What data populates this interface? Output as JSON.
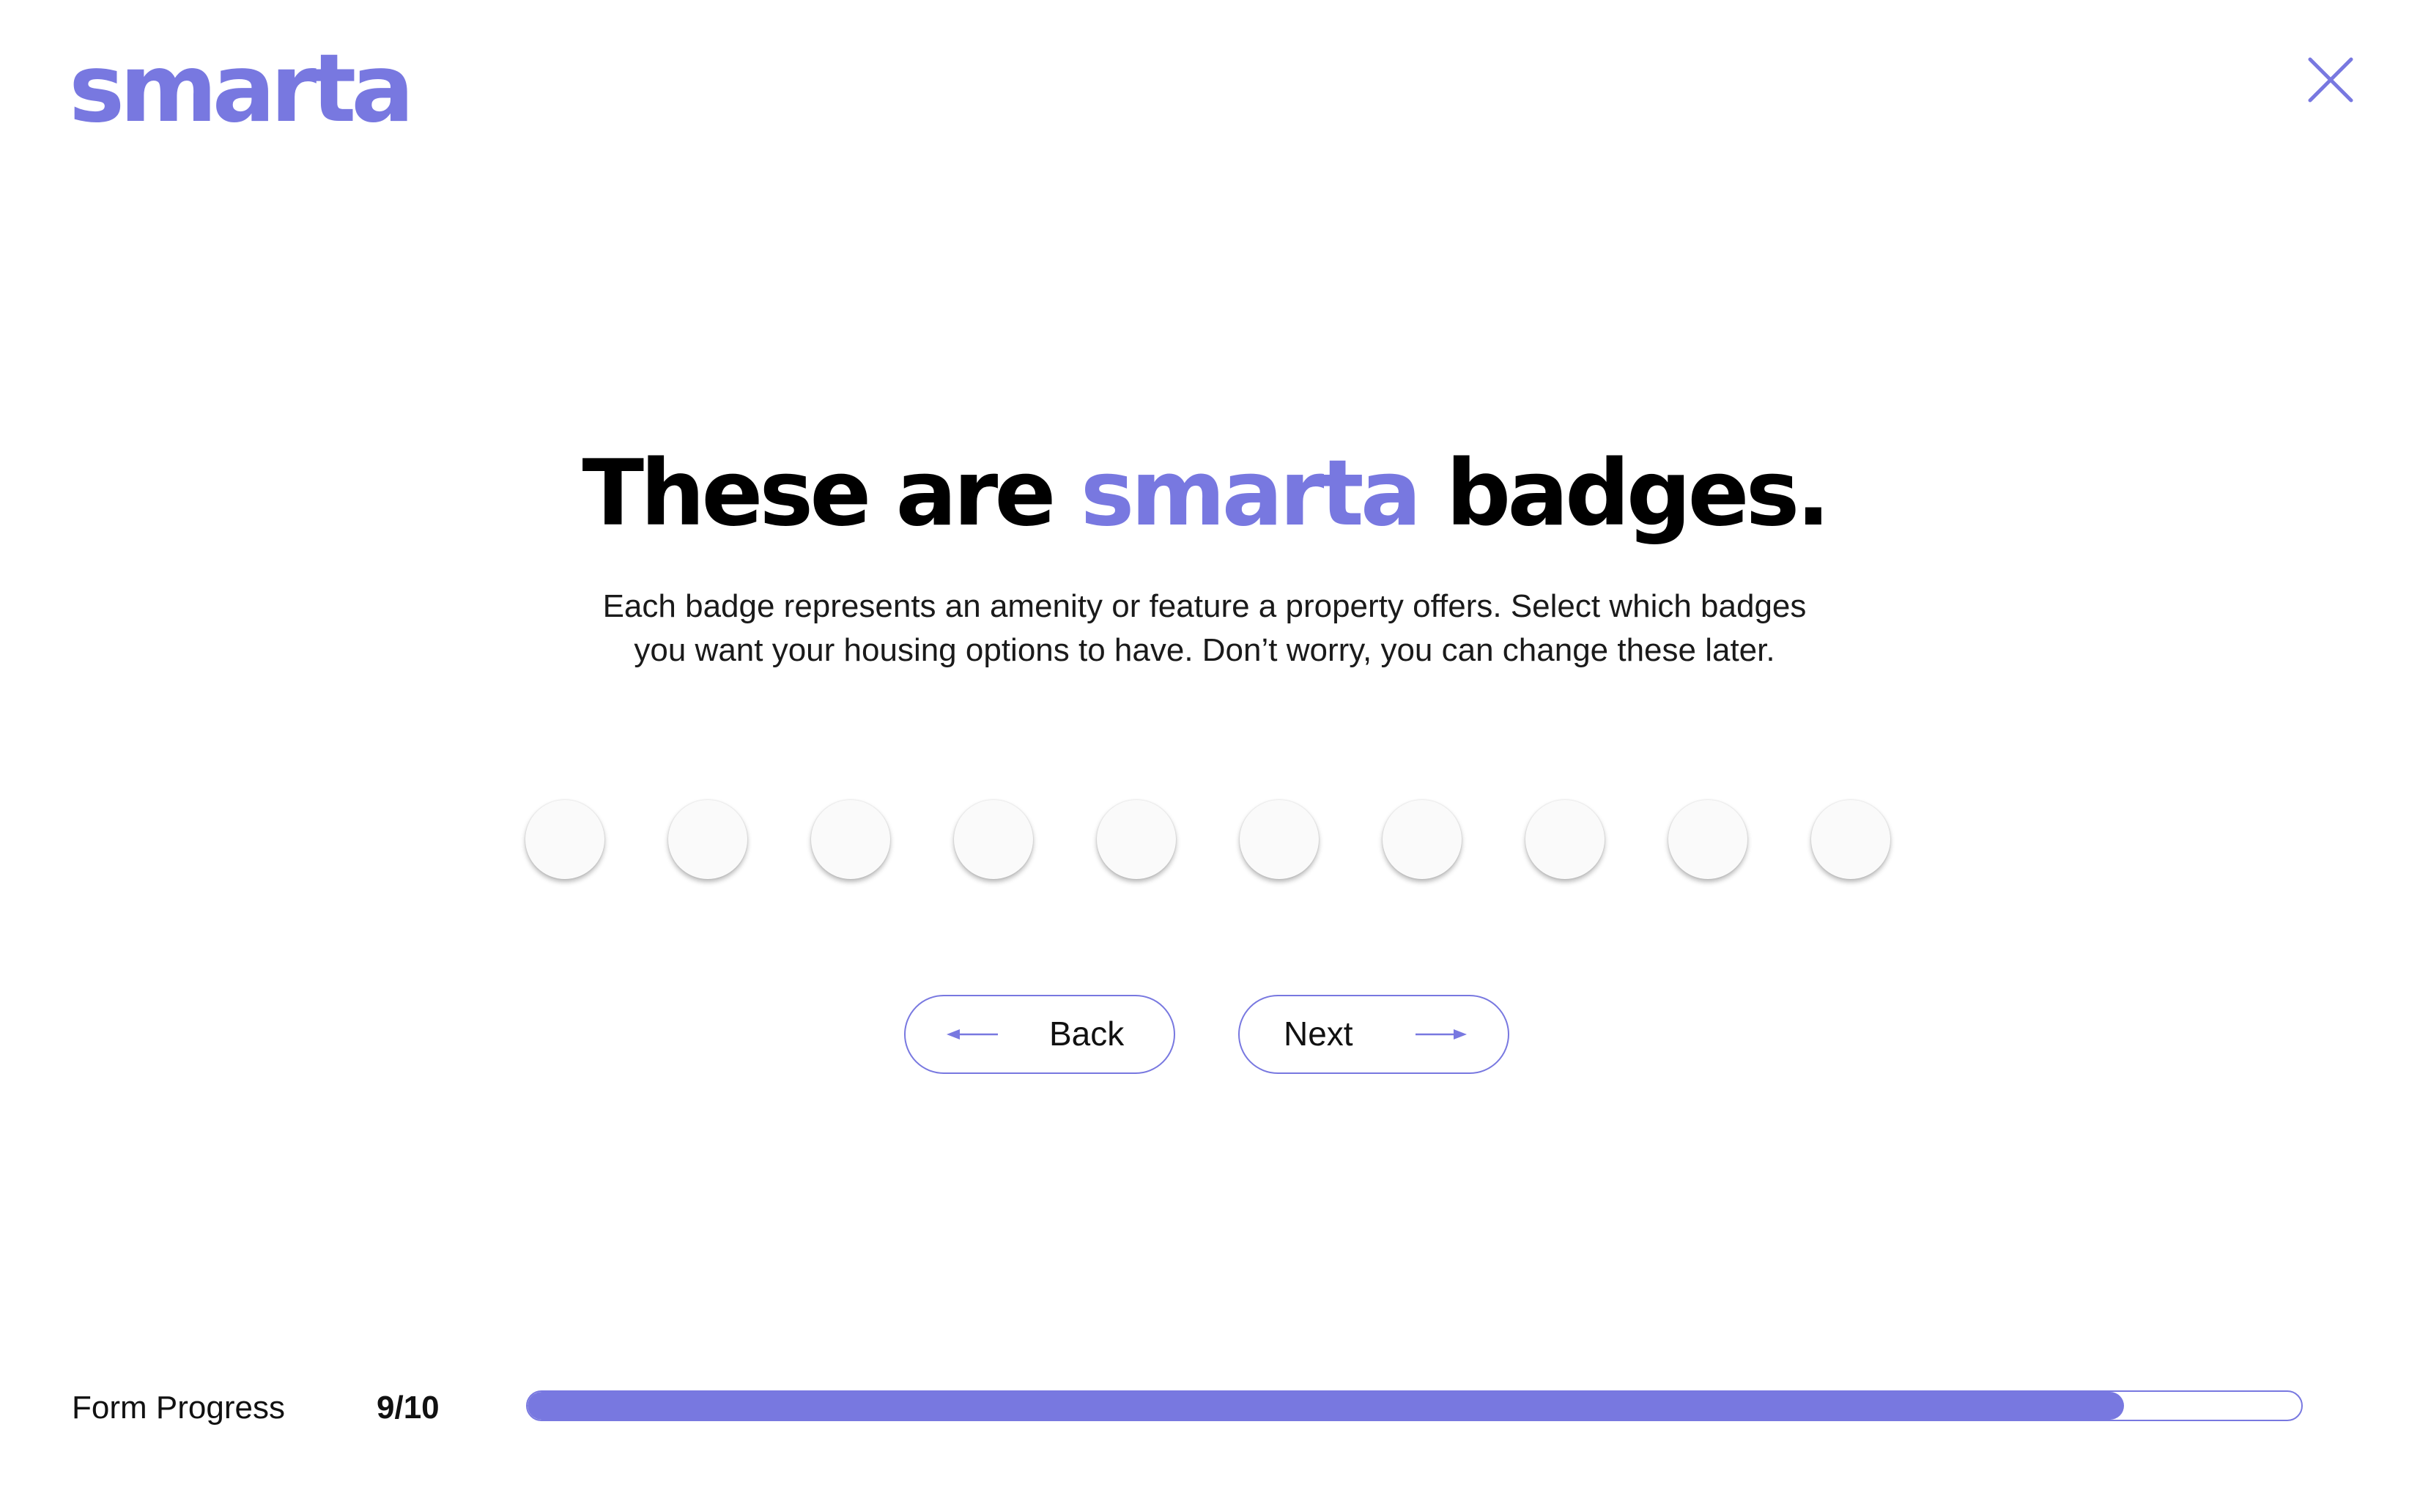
{
  "brand": {
    "logo_text": "smarta",
    "color": "#7878e0"
  },
  "header": {
    "close_icon": "close-icon"
  },
  "main": {
    "headline_before": "These are ",
    "headline_brand": "smarta",
    "headline_after": " badges.",
    "description": "Each badge represents an amenity or feature a property offers. Select which badges you want your housing options to have. Don’t worry, you can change these later.",
    "badges": [
      {
        "selected": false
      },
      {
        "selected": false
      },
      {
        "selected": false
      },
      {
        "selected": false
      },
      {
        "selected": false
      },
      {
        "selected": false
      },
      {
        "selected": false
      },
      {
        "selected": false
      },
      {
        "selected": false
      },
      {
        "selected": false
      }
    ]
  },
  "navigation": {
    "back_label": "Back",
    "back_icon": "arrow-left-icon",
    "next_label": "Next",
    "next_icon": "arrow-right-icon"
  },
  "footer": {
    "progress_label": "Form Progress",
    "progress_text": "9/10",
    "progress_fraction": 0.9
  }
}
